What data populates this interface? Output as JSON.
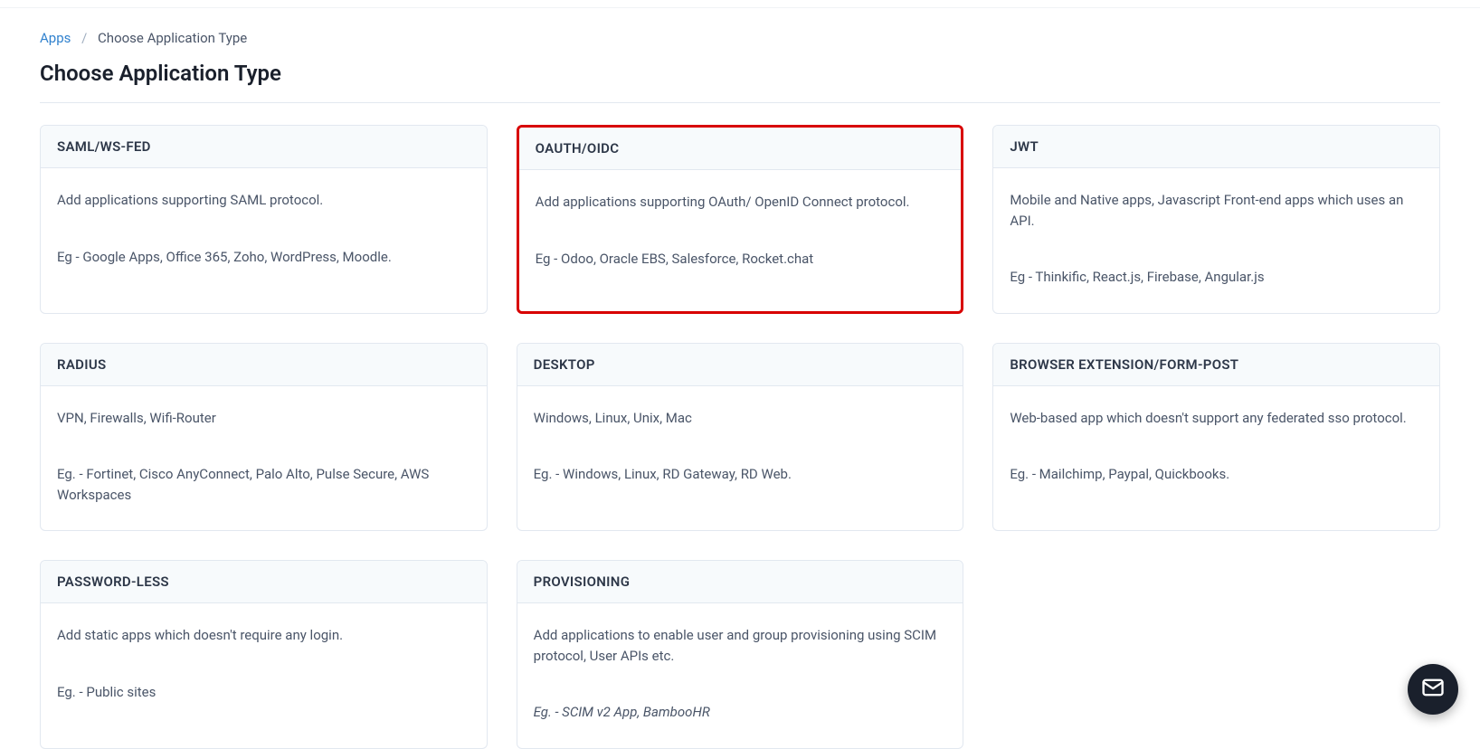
{
  "breadcrumb": {
    "root": "Apps",
    "current": "Choose Application Type"
  },
  "page_title": "Choose Application Type",
  "cards": [
    {
      "title": "SAML/WS-FED",
      "description": "Add applications supporting SAML protocol.",
      "example": "Eg - Google Apps, Office 365, Zoho, WordPress, Moodle.",
      "highlighted": false,
      "italic": false,
      "name": "card-saml-ws-fed"
    },
    {
      "title": "OAUTH/OIDC",
      "description": "Add applications supporting OAuth/ OpenID Connect protocol.",
      "example": "Eg - Odoo, Oracle EBS, Salesforce, Rocket.chat",
      "highlighted": true,
      "italic": false,
      "name": "card-oauth-oidc"
    },
    {
      "title": "JWT",
      "description": "Mobile and Native apps, Javascript Front-end apps which uses an API.",
      "example": "Eg - Thinkific, React.js, Firebase, Angular.js",
      "highlighted": false,
      "italic": false,
      "name": "card-jwt"
    },
    {
      "title": "RADIUS",
      "description": "VPN, Firewalls, Wifi-Router",
      "example": "Eg. - Fortinet, Cisco AnyConnect, Palo Alto, Pulse Secure, AWS Workspaces",
      "highlighted": false,
      "italic": false,
      "name": "card-radius"
    },
    {
      "title": "DESKTOP",
      "description": "Windows, Linux, Unix, Mac",
      "example": "Eg. - Windows, Linux, RD Gateway, RD Web.",
      "highlighted": false,
      "italic": false,
      "name": "card-desktop"
    },
    {
      "title": "BROWSER EXTENSION/FORM-POST",
      "description": "Web-based app which doesn't support any federated sso protocol.",
      "example": "Eg. - Mailchimp, Paypal, Quickbooks.",
      "highlighted": false,
      "italic": false,
      "name": "card-browser-extension"
    },
    {
      "title": "PASSWORD-LESS",
      "description": "Add static apps which doesn't require any login.",
      "example": "Eg. - Public sites",
      "highlighted": false,
      "italic": false,
      "name": "card-password-less"
    },
    {
      "title": "PROVISIONING",
      "description": "Add applications to enable user and group provisioning using SCIM protocol, User APIs etc.",
      "example": "Eg. - SCIM v2 App, BambooHR",
      "highlighted": false,
      "italic": true,
      "name": "card-provisioning"
    }
  ]
}
